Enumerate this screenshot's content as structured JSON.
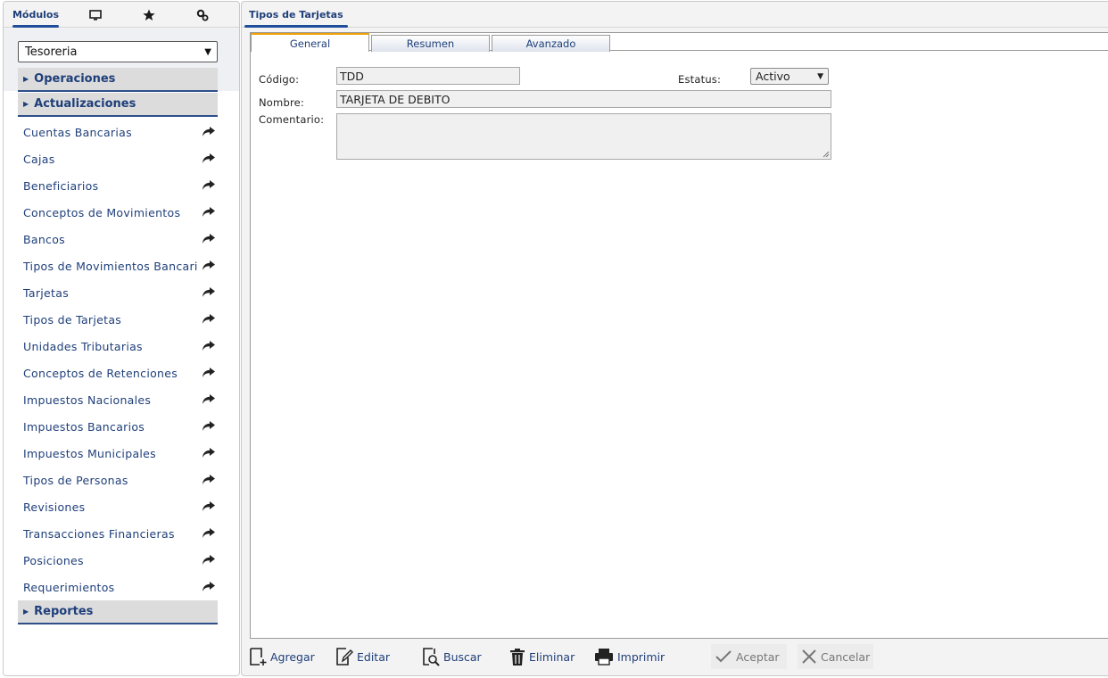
{
  "left": {
    "tabs": {
      "modules_label": "Módulos",
      "desktop_icon": "monitor-icon",
      "favorites_icon": "star-icon",
      "settings_icon": "gear-icon"
    },
    "module_select": {
      "value": "Tesoreria"
    },
    "sections": {
      "operaciones": "Operaciones",
      "actualizaciones": "Actualizaciones",
      "reportes": "Reportes"
    },
    "items": [
      "Cuentas Bancarias",
      "Cajas",
      "Beneficiarios",
      "Conceptos de Movimientos",
      "Bancos",
      "Tipos de Movimientos Bancarios",
      "Tarjetas",
      "Tipos de Tarjetas",
      "Unidades Tributarias",
      "Conceptos de Retenciones",
      "Impuestos Nacionales",
      "Impuestos Bancarios",
      "Impuestos Municipales",
      "Tipos de Personas",
      "Revisiones",
      "Transacciones Financieras",
      "Posiciones",
      "Requerimientos"
    ]
  },
  "right": {
    "tab_title": "Tipos de Tarjetas",
    "subtabs": [
      "General",
      "Resumen",
      "Avanzado"
    ],
    "form": {
      "codigo_label": "Código:",
      "codigo_value": "TDD",
      "estatus_label": "Estatus:",
      "estatus_value": "Activo",
      "nombre_label": "Nombre:",
      "nombre_value": "TARJETA DE DEBITO",
      "comentario_label": "Comentario:",
      "comentario_value": ""
    },
    "toolbar": {
      "agregar": "Agregar",
      "editar": "Editar",
      "buscar": "Buscar",
      "eliminar": "Eliminar",
      "imprimir": "Imprimir",
      "aceptar": "Aceptar",
      "cancelar": "Cancelar"
    }
  },
  "colors": {
    "accent_blue": "#1f3f7a",
    "active_tab_orange": "#f0a000",
    "section_bg": "#dcdcdc"
  }
}
